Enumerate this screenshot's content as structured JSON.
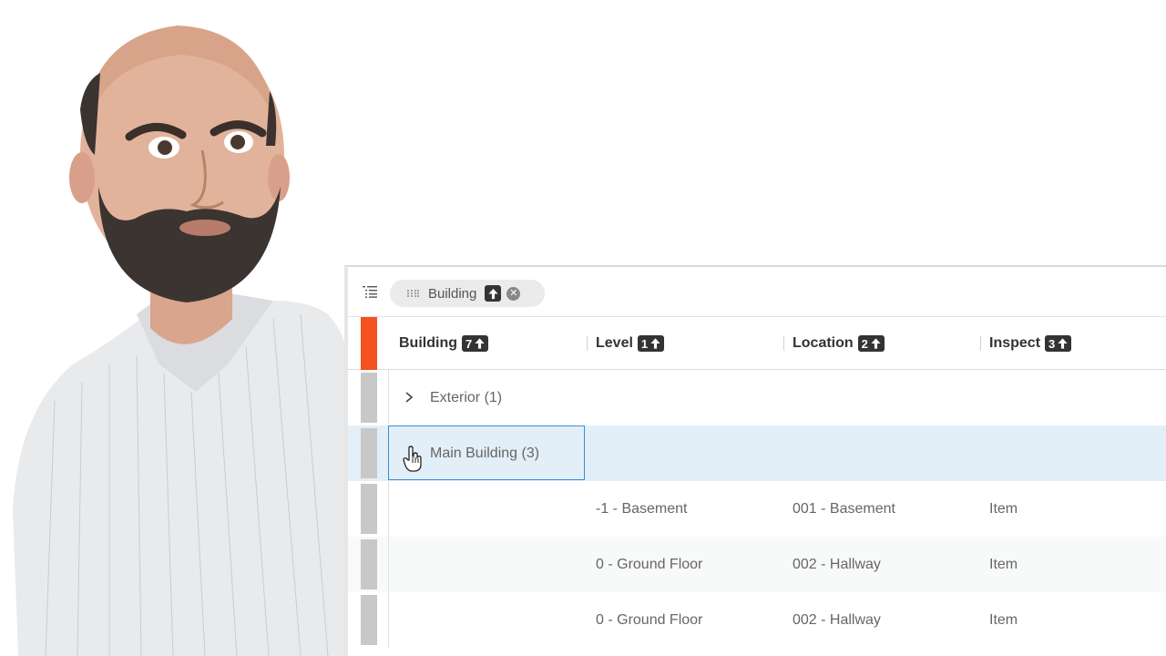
{
  "grouping": {
    "chip_label": "Building",
    "icons": {
      "tree": "tree-list-icon",
      "grip": "drag-grip-icon",
      "sort": "sort-asc-icon",
      "remove": "remove-circle-icon"
    }
  },
  "columns": [
    {
      "label": "Building",
      "sort_order": "7"
    },
    {
      "label": "Level",
      "sort_order": "1"
    },
    {
      "label": "Location",
      "sort_order": "2"
    },
    {
      "label": "Inspect",
      "sort_order": "3"
    }
  ],
  "groups": [
    {
      "label": "Exterior (1)",
      "expanded": false
    },
    {
      "label": "Main Building (3)",
      "expanded": true,
      "selected": true
    }
  ],
  "rows": [
    {
      "level": "-1 - Basement",
      "location": "001 - Basement",
      "inspect": "Item"
    },
    {
      "level": "0 - Ground Floor",
      "location": "002 - Hallway",
      "inspect": "Item"
    },
    {
      "level": "0 - Ground Floor",
      "location": "002 - Hallway",
      "inspect": "Item"
    }
  ],
  "colors": {
    "accent": "#f4511e",
    "selected_row": "#e2eff8",
    "focus_border": "#3a8bd6",
    "badge": "#333333"
  }
}
